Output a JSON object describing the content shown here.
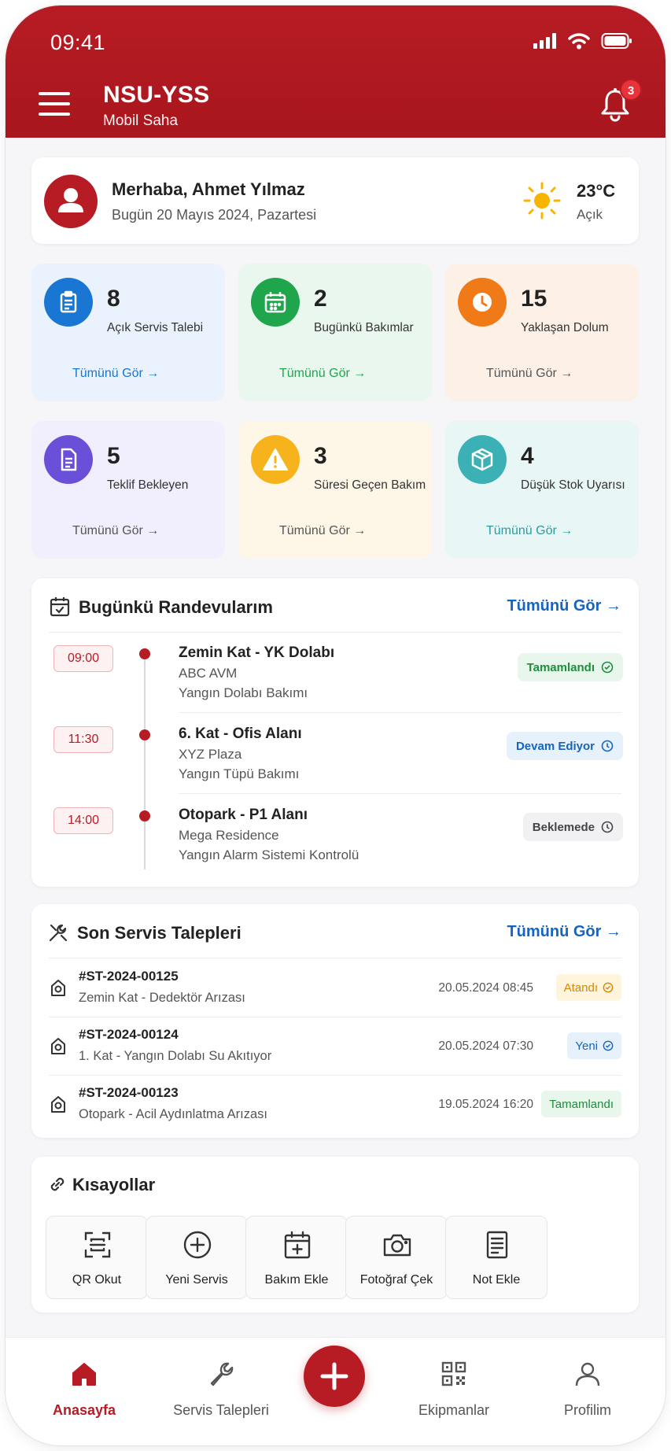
{
  "status_bar": {
    "time": "09:41"
  },
  "header": {
    "title": "NSU-YSS",
    "subtitle": "Mobil Saha",
    "notification_count": "3"
  },
  "greeting": {
    "name": "Merhaba, Ahmet Yılmaz",
    "date": "Bugün 20 Mayıs 2024, Pazartesi",
    "temperature": "23°C",
    "weather": "Açık"
  },
  "stats": [
    {
      "value": "8",
      "label": "Açık Servis Talebi",
      "link": "Tümünü Gör →",
      "icon": "clipboard-icon",
      "color": "#1976d2",
      "bg": "#eaf3fd"
    },
    {
      "value": "2",
      "label": "Bugünkü Bakımlar",
      "link": "Tümünü Gör →",
      "icon": "calendar-icon",
      "color": "#1fa54c",
      "bg": "#eaf7ef"
    },
    {
      "value": "15",
      "label": "Yaklaşan Dolum",
      "link": "Tümünü Gör →",
      "icon": "clock-icon",
      "color": "#f07a18",
      "bg": "#fdf0e6"
    },
    {
      "value": "5",
      "label": "Teklif Bekleyen",
      "link": "Tümünü Gör →",
      "icon": "document-icon",
      "color": "#6a4fd8",
      "bg": "#f1effd"
    },
    {
      "value": "3",
      "label": "Süresi Geçen Bakım",
      "link": "Tümünü Gör →",
      "icon": "warning-icon",
      "color": "#f6b31b",
      "bg": "#fef6e6"
    },
    {
      "value": "4",
      "label": "Düşük Stok Uyarısı",
      "link": "Tümünü Gör →",
      "icon": "box-icon",
      "color": "#3bb1b6",
      "bg": "#e9f6f6"
    }
  ],
  "appointments": {
    "title": "Bugünkü Randevularım",
    "see_all": "Tümünü Gör →",
    "items": [
      {
        "time": "09:00",
        "title": "Zemin Kat - YK Dolabı",
        "place": "ABC AVM",
        "type": "Yangın Dolabı Bakımı",
        "status": "Tamamlandı",
        "status_color": "#1e8e3e",
        "status_bg": "#e8f6ec"
      },
      {
        "time": "11:30",
        "title": "6. Kat - Ofis Alanı",
        "place": "XYZ Plaza",
        "type": "Yangın Tüpü Bakımı",
        "status": "Devam Ediyor",
        "status_color": "#1565c0",
        "status_bg": "#e7f1fc"
      },
      {
        "time": "14:00",
        "title": "Otopark - P1 Alanı",
        "place": "Mega Residence",
        "type": "Yangın Alarm Sistemi Kontrolü",
        "status": "Beklemede",
        "status_color": "#444444",
        "status_bg": "#f1f1f3"
      }
    ]
  },
  "service_requests": {
    "title": "Son Servis Talepleri",
    "see_all": "Tümünü Gör →",
    "items": [
      {
        "id": "#ST-2024-00125",
        "desc": "Zemin Kat - Dedektör Arızası",
        "date": "20.05.2024 08:45",
        "badge": "Atandı",
        "badge_color": "#d48806",
        "badge_bg": "#fff4dc"
      },
      {
        "id": "#ST-2024-00124",
        "desc": "1. Kat - Yangın Dolabı Su Akıtıyor",
        "date": "20.05.2024 07:30",
        "badge": "Yeni",
        "badge_color": "#1565c0",
        "badge_bg": "#e7f1fc"
      },
      {
        "id": "#ST-2024-00123",
        "desc": "Otopark - Acil Aydınlatma Arızası",
        "date": "19.05.2024 16:20",
        "badge": "Tamamlandı",
        "badge_color": "#1e8e3e",
        "badge_bg": "#e8f6ec"
      }
    ]
  },
  "shortcuts": {
    "title": "Kısayollar",
    "items": [
      {
        "label": "QR Okut",
        "icon": "qr-scan-icon"
      },
      {
        "label": "Yeni Servis",
        "icon": "plus-circle-icon"
      },
      {
        "label": "Bakım Ekle",
        "icon": "calendar-plus-icon"
      },
      {
        "label": "Fotoğraf Çek",
        "icon": "camera-icon"
      },
      {
        "label": "Not Ekle",
        "icon": "note-icon"
      }
    ]
  },
  "tabbar": {
    "items": [
      {
        "label": "Anasayfa",
        "icon": "home-icon",
        "active": true
      },
      {
        "label": "Servis Talepleri",
        "icon": "wrench-icon",
        "active": false
      },
      {
        "label": "Ekipmanlar",
        "icon": "qr-code-icon",
        "active": false
      },
      {
        "label": "Profilim",
        "icon": "user-icon",
        "active": false
      }
    ]
  },
  "colors": {
    "brand": "#b71c24",
    "link_blue": "#1565c0"
  }
}
